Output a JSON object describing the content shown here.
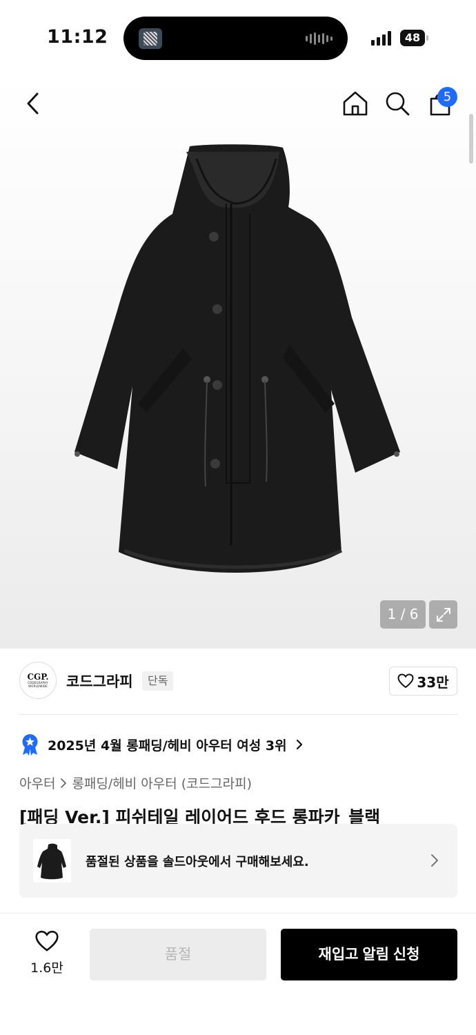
{
  "status_bar": {
    "time": "11:12",
    "battery": "48"
  },
  "header": {
    "cart_count": "5"
  },
  "gallery": {
    "counter": "1 / 6"
  },
  "brand": {
    "logo_big": "CGP.",
    "logo_small_1": "CODEGRAPHY",
    "logo_small_2": "WORLDWIDE",
    "name": "코드그라피",
    "badge": "단독",
    "likes": "33만"
  },
  "ranking": {
    "text": "2025년 4월 롱패딩/헤비 아우터 여성 3위"
  },
  "breadcrumb": {
    "category": "아우터",
    "subcategory": "롱패딩/헤비 아우터 (코드그라피)"
  },
  "product": {
    "title": "[패딩 Ver.] 피쉬테일 레이어드 후드 롱파카_블랙"
  },
  "soldout_banner": {
    "text": "품절된 상품을 솔드아웃에서 구매해보세요."
  },
  "bottom_bar": {
    "wish_count": "1.6만",
    "soldout_label": "품절",
    "restock_label": "재입고 알림 신청"
  }
}
